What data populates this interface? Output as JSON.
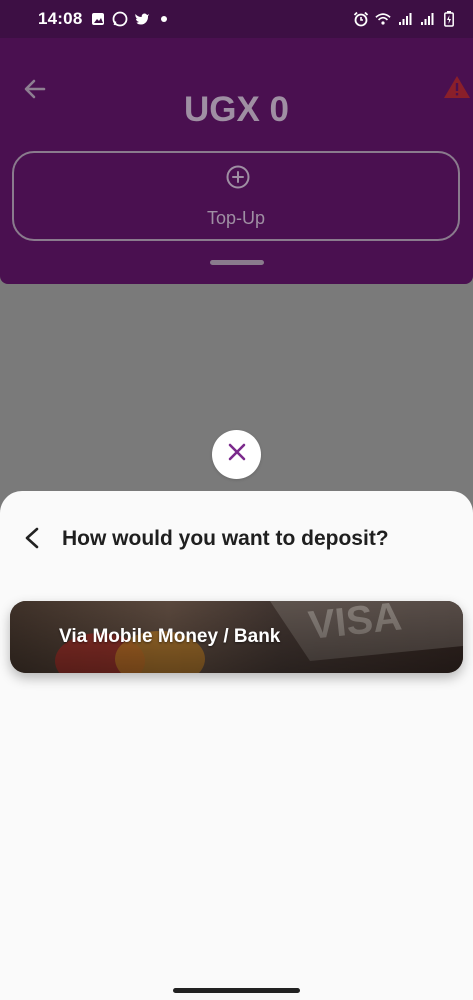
{
  "status_bar": {
    "time": "14:08",
    "left_icons": [
      "gallery-icon",
      "whatsapp-icon",
      "twitter-icon",
      "dot-icon"
    ],
    "right_icons": [
      "alarm-icon",
      "wifi-icon",
      "signal-icon",
      "signal-icon",
      "battery-icon"
    ]
  },
  "header": {
    "balance": "UGX 0",
    "topup_label": "Top-Up"
  },
  "sheet": {
    "title": "How would you want to deposit?",
    "options": [
      {
        "label": "Via Mobile Money / Bank"
      }
    ]
  },
  "colors": {
    "brand_purple": "#4a1050",
    "status_bar": "#3d0f44",
    "close_icon": "#7b2a8c",
    "warning": "#8a1f2a"
  }
}
